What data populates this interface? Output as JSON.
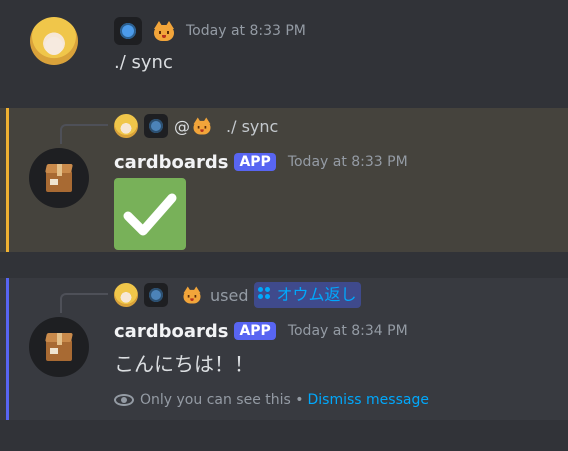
{
  "messages": [
    {
      "time": "Today at 8:33 PM",
      "content": "./ sync"
    },
    {
      "reply": {
        "at": "@",
        "command": "./ sync"
      },
      "author": "cardboards",
      "badge": "APP",
      "time": "Today at 8:33 PM",
      "attachment": "checkmark-emoji",
      "highlight_color": "#f0b232"
    },
    {
      "interaction": {
        "used": "used",
        "command": "オウム返し"
      },
      "author": "cardboards",
      "badge": "APP",
      "time": "Today at 8:34 PM",
      "content": "こんにちは！！",
      "ephemeral": {
        "text": "Only you can see this •",
        "dismiss": "Dismiss message"
      },
      "highlight_color": "#5865f2"
    }
  ],
  "colors": {
    "background": "#313338",
    "app_badge": "#5865f2",
    "link": "#00a8fc",
    "check_bg": "#78b159"
  }
}
